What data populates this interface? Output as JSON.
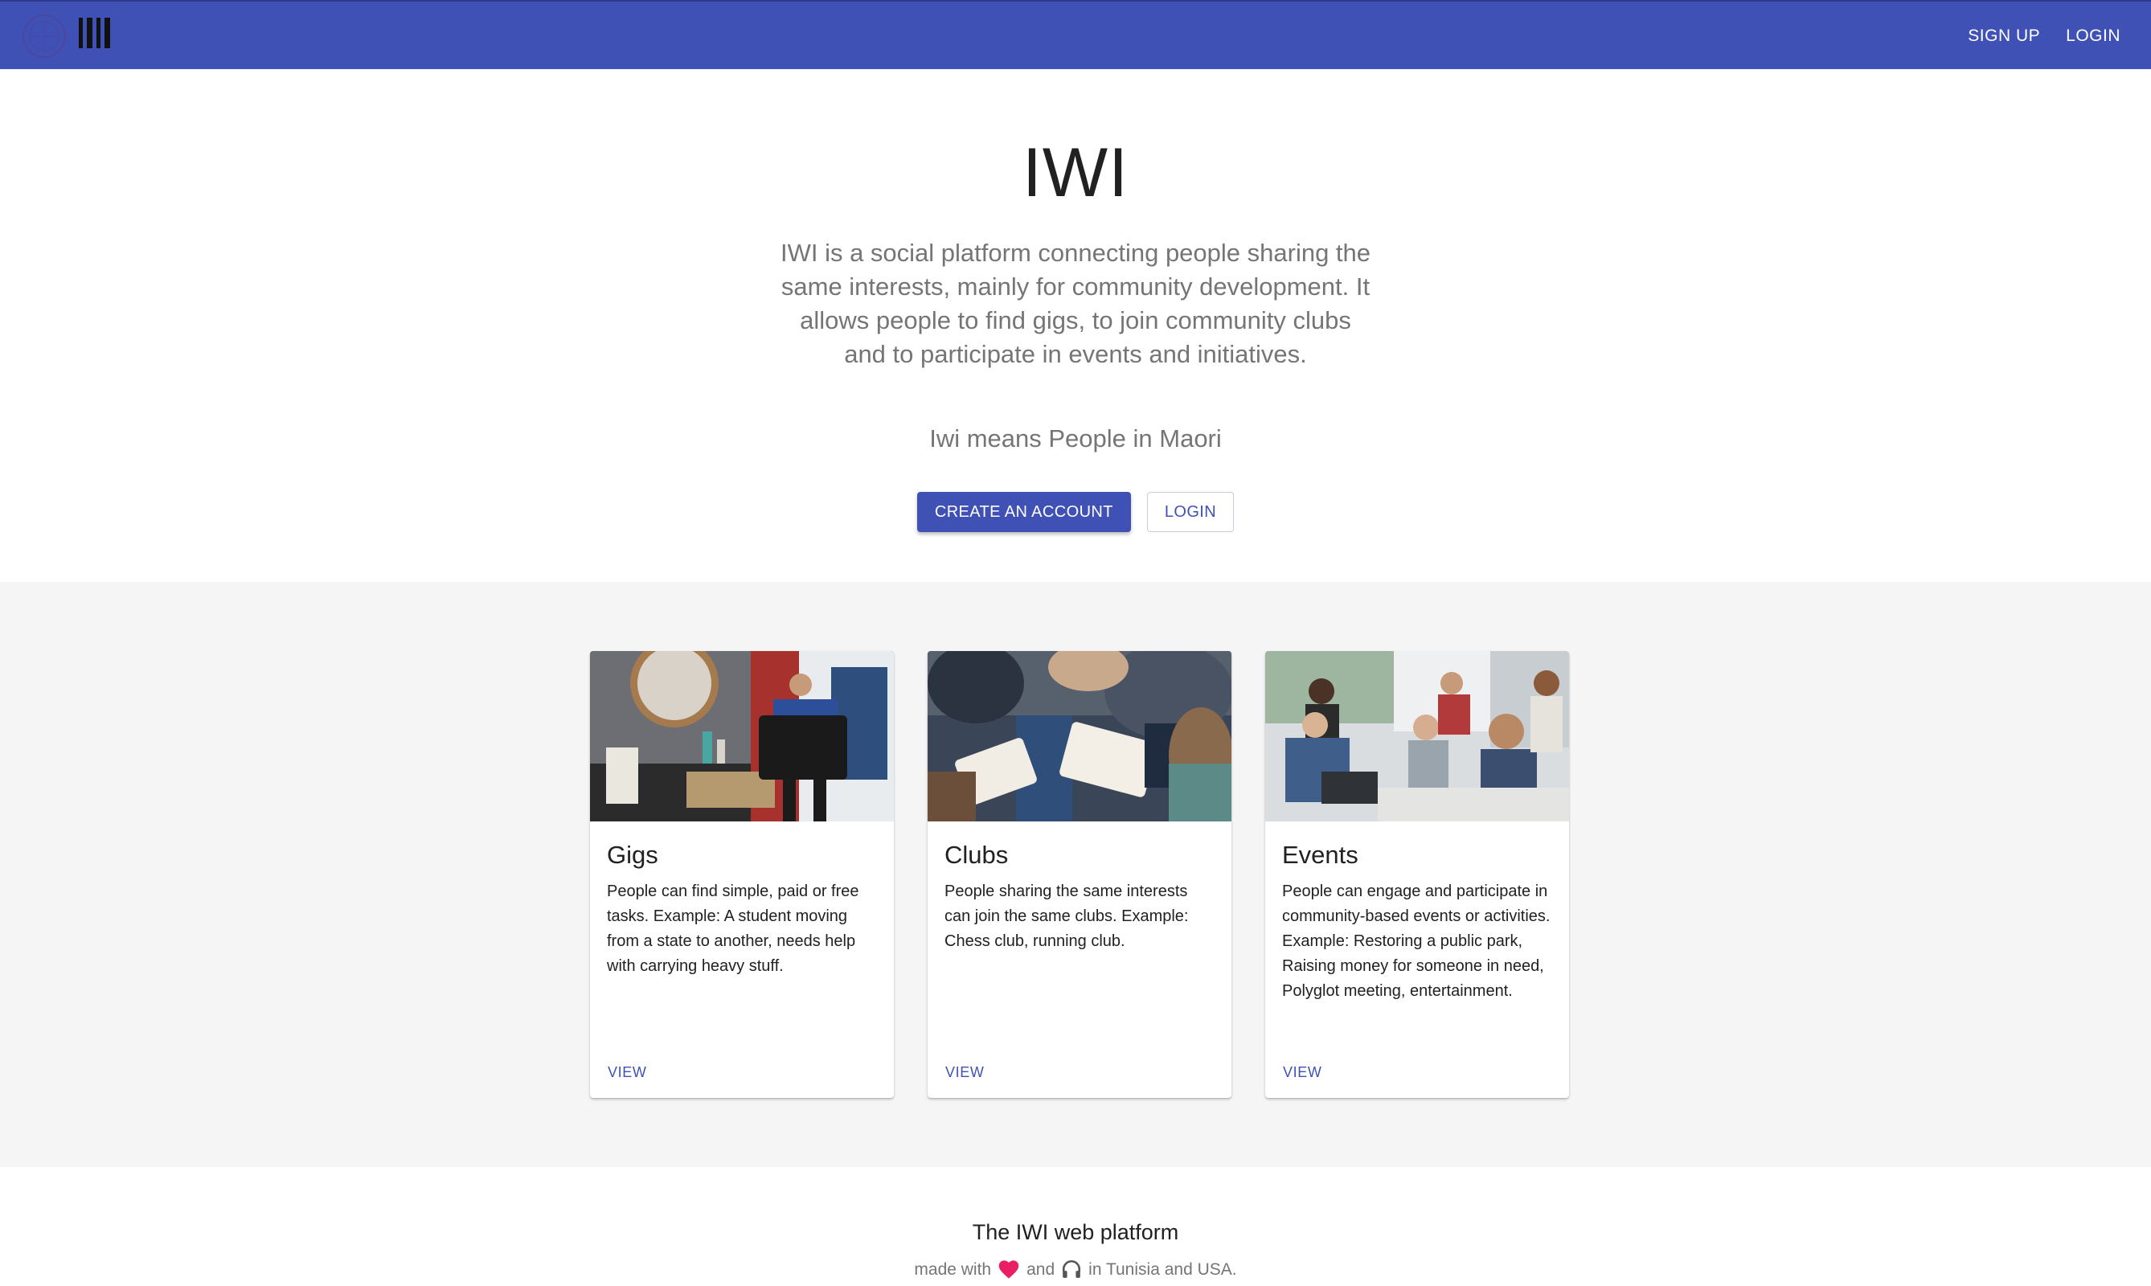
{
  "app": {
    "logo_icon": "iwi-circle-logo-icon",
    "wordmark_icon": "iwi-bars-wordmark-icon",
    "brand_color": "#3f51b5"
  },
  "nav": {
    "signup_label": "SIGN UP",
    "login_label": "LOGIN"
  },
  "hero": {
    "title": "IWI",
    "description": "IWI is a social platform connecting people sharing the same interests, mainly for community development. It allows people to find gigs, to join community clubs and to participate in events and initiatives.",
    "subtitle": "Iwi means People in Maori",
    "create_account_label": "CREATE AN ACCOUNT",
    "login_label": "LOGIN"
  },
  "cards": [
    {
      "title": "Gigs",
      "text": "People can find simple, paid or free tasks. Example: A student moving from a state to another, needs help with carrying heavy stuff.",
      "action": "VIEW",
      "image": "person-carrying-crate-photo"
    },
    {
      "title": "Clubs",
      "text": "People sharing the same interests can join the same clubs. Example: Chess club, running club.",
      "action": "VIEW",
      "image": "group-reading-books-photo"
    },
    {
      "title": "Events",
      "text": "People can engage and participate in community-based events or activities. Example: Restoring a public park, Raising money for someone in need, Polyglot meeting, entertainment.",
      "action": "VIEW",
      "image": "office-meeting-photo"
    }
  ],
  "footer": {
    "title": "The IWI web platform",
    "made_with": "made with",
    "and": "and",
    "location": "in Tunisia and USA.",
    "heart_icon": "heart-icon",
    "headphones_icon": "headphones-icon",
    "heart_color": "#e91e63"
  }
}
